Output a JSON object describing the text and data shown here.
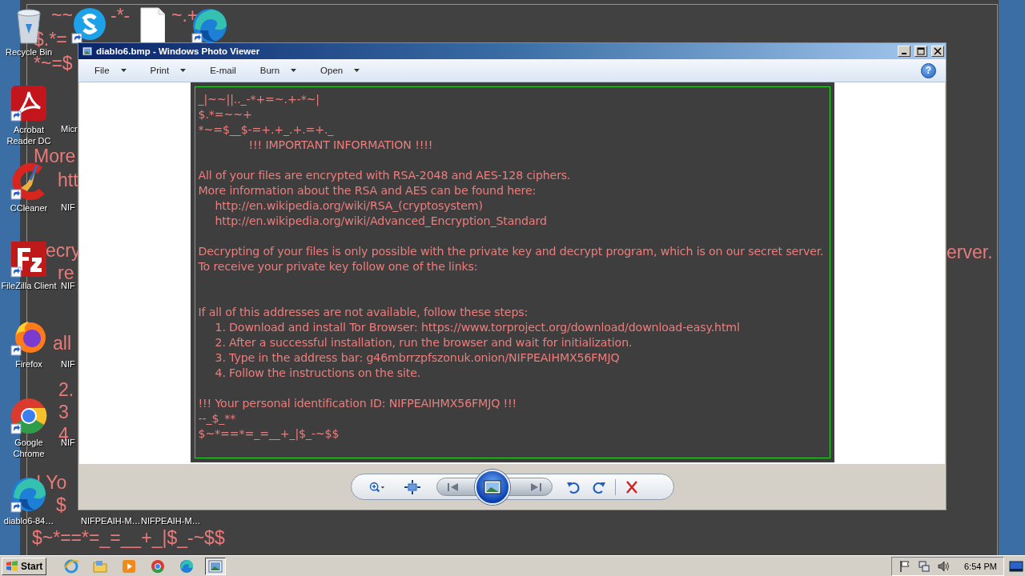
{
  "wallpaper": {
    "fragments": [
      "~~",
      "-*-",
      "~.+",
      "$.*=",
      "*~=$",
      "More",
      "htt",
      "ecry",
      "re",
      "all",
      "2.",
      "3",
      "4",
      "! Yo",
      "$",
      "$~*==*=_=__+_|$_-~$$",
      "erver."
    ]
  },
  "desktop_icons": [
    {
      "kind": "recycle-bin",
      "label": "Recycle Bin"
    },
    {
      "kind": "skype"
    },
    {
      "kind": "file"
    },
    {
      "kind": "edge"
    },
    {
      "kind": "acrobat",
      "label": "Acrobat Reader DC"
    },
    {
      "kind": "ccleaner",
      "label": "CCleaner"
    },
    {
      "kind": "filezilla",
      "label": "FileZilla Client"
    },
    {
      "kind": "firefox",
      "label": "Firefox"
    },
    {
      "kind": "chrome",
      "label": "Google Chrome"
    },
    {
      "kind": "edge",
      "label": "diablo6-84…"
    },
    {
      "kind": "covered",
      "label": "Micr"
    },
    {
      "kind": "covered",
      "label": "NIF"
    },
    {
      "kind": "covered",
      "label": "NIF"
    },
    {
      "kind": "covered",
      "label": "NIF"
    },
    {
      "kind": "covered",
      "label": "NIF"
    },
    {
      "kind": "covered",
      "label": "NIFPEAIH-M…"
    },
    {
      "kind": "covered",
      "label": "NIFPEAIH-M…"
    }
  ],
  "window": {
    "title": "diablo6.bmp - Windows Photo Viewer",
    "menu": [
      {
        "label": "File",
        "has_menu": true
      },
      {
        "label": "Print",
        "has_menu": true
      },
      {
        "label": "E-mail",
        "has_menu": false
      },
      {
        "label": "Burn",
        "has_menu": true
      },
      {
        "label": "Open",
        "has_menu": true
      }
    ],
    "help": "?",
    "note": {
      "lines": [
        {
          "kind": "plain",
          "text": "_|~~||.._-*+=~.+-*~|"
        },
        {
          "kind": "plain",
          "text": "$.*=~~+"
        },
        {
          "kind": "plain",
          "text": "*~=$__$-=+.+_.+.=+._"
        },
        {
          "kind": "heading",
          "text": "!!! IMPORTANT INFORMATION !!!!"
        },
        {
          "kind": "gap"
        },
        {
          "kind": "plain",
          "text": "All of your files are encrypted with RSA-2048 and AES-128 ciphers."
        },
        {
          "kind": "plain",
          "text": "More information about the RSA and AES can be found here:"
        },
        {
          "kind": "indented",
          "text": "http://en.wikipedia.org/wiki/RSA_(cryptosystem)"
        },
        {
          "kind": "indented",
          "text": "http://en.wikipedia.org/wiki/Advanced_Encryption_Standard"
        },
        {
          "kind": "gap"
        },
        {
          "kind": "plain",
          "text": "Decrypting of your files is only possible with the private key and decrypt program, which is on our secret server."
        },
        {
          "kind": "plain",
          "text": "To receive your private key follow one of the links:"
        },
        {
          "kind": "gap"
        },
        {
          "kind": "gap"
        },
        {
          "kind": "plain",
          "text": "If all of this addresses are not available, follow these steps:"
        },
        {
          "kind": "indented",
          "text": "1. Download and install Tor Browser: https://www.torproject.org/download/download-easy.html"
        },
        {
          "kind": "indented",
          "text": "2. After a successful installation, run the browser and wait for initialization."
        },
        {
          "kind": "indented",
          "text": "3. Type in the address bar: g46mbrrzpfszonuk.onion/NIFPEAIHMX56FMJQ"
        },
        {
          "kind": "indented",
          "text": "4. Follow the instructions on the site."
        },
        {
          "kind": "gap"
        },
        {
          "kind": "plain",
          "text": "!!! Your personal identification ID: NIFPEAIHMX56FMJQ !!!"
        },
        {
          "kind": "plain",
          "text": "--_$_**"
        },
        {
          "kind": "plain",
          "text": "$~*==*=_=__+_|$_-~$$"
        }
      ]
    }
  },
  "taskbar": {
    "start": "Start",
    "apps": [
      {
        "kind": "ie",
        "selected": false
      },
      {
        "kind": "folder",
        "selected": false
      },
      {
        "kind": "media",
        "selected": false
      },
      {
        "kind": "chrome",
        "selected": false
      },
      {
        "kind": "edge",
        "selected": false
      },
      {
        "kind": "photo-viewer",
        "selected": true
      }
    ],
    "clock": "6:54 PM"
  }
}
